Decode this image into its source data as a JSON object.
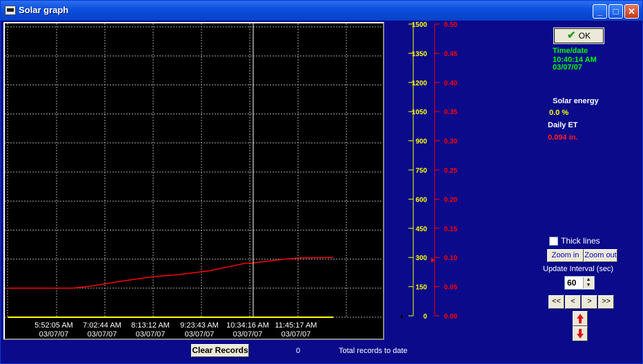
{
  "window": {
    "title": "Solar graph",
    "min": "_",
    "max": "□",
    "close": "✕"
  },
  "chart_data": {
    "type": "line",
    "x_ticks": [
      "5:52:05 AM",
      "7:02:44 AM",
      "8:13:12 AM",
      "9:23:43 AM",
      "10:34:16 AM",
      "11:45:17 AM"
    ],
    "x_tick_dates": [
      "03/07/07",
      "03/07/07",
      "03/07/07",
      "03/07/07",
      "03/07/07",
      "03/07/07"
    ],
    "y_left": {
      "ticks": [
        "1500",
        "1350",
        "1200",
        "1050",
        "900",
        "750",
        "600",
        "450",
        "300",
        "150",
        "0"
      ],
      "ylim": [
        0,
        1500
      ],
      "color": "#ffff00"
    },
    "y_right": {
      "ticks": [
        "0.50",
        "0.45",
        "0.40",
        "0.35",
        "0.30",
        "0.25",
        "0.20",
        "0.15",
        "0.10",
        "0.05",
        "0.00"
      ],
      "ylim": [
        0,
        0.5
      ],
      "color": "#ff0000"
    },
    "grid": true,
    "series": [
      {
        "axis": "right",
        "color": "#ff0000",
        "x": [
          0,
          0.2,
          0.25,
          0.35,
          0.45,
          0.52,
          0.62,
          0.68,
          0.73,
          0.75,
          0.85,
          0.9,
          1.0
        ],
        "values": [
          0.05,
          0.05,
          0.053,
          0.062,
          0.07,
          0.073,
          0.08,
          0.087,
          0.093,
          0.093,
          0.1,
          0.102,
          0.103
        ]
      },
      {
        "axis": "left",
        "color": "#ffff00",
        "x": [
          0,
          1.0
        ],
        "values": [
          0,
          0
        ]
      }
    ],
    "cursor_x": 0.762
  },
  "side": {
    "ok_label": "OK",
    "time_heading": "Time/date",
    "time_value": "10:40:14 AM",
    "date_value": "03/07/07",
    "solar_heading": "Solar energy",
    "solar_value": "0.0 %",
    "et_heading": "Daily ET",
    "et_value": "0.094 in.",
    "thick_lines": "Thick lines",
    "zoom_in": "Zoom in",
    "zoom_out": "Zoom out",
    "update_interval": "Update Interval (sec)",
    "interval_value": "60",
    "nav": [
      "<<",
      "<",
      ">",
      ">>"
    ]
  },
  "bottom": {
    "clear_label": "Clear Records",
    "record_count": "0",
    "records_label": "Total records to date"
  }
}
